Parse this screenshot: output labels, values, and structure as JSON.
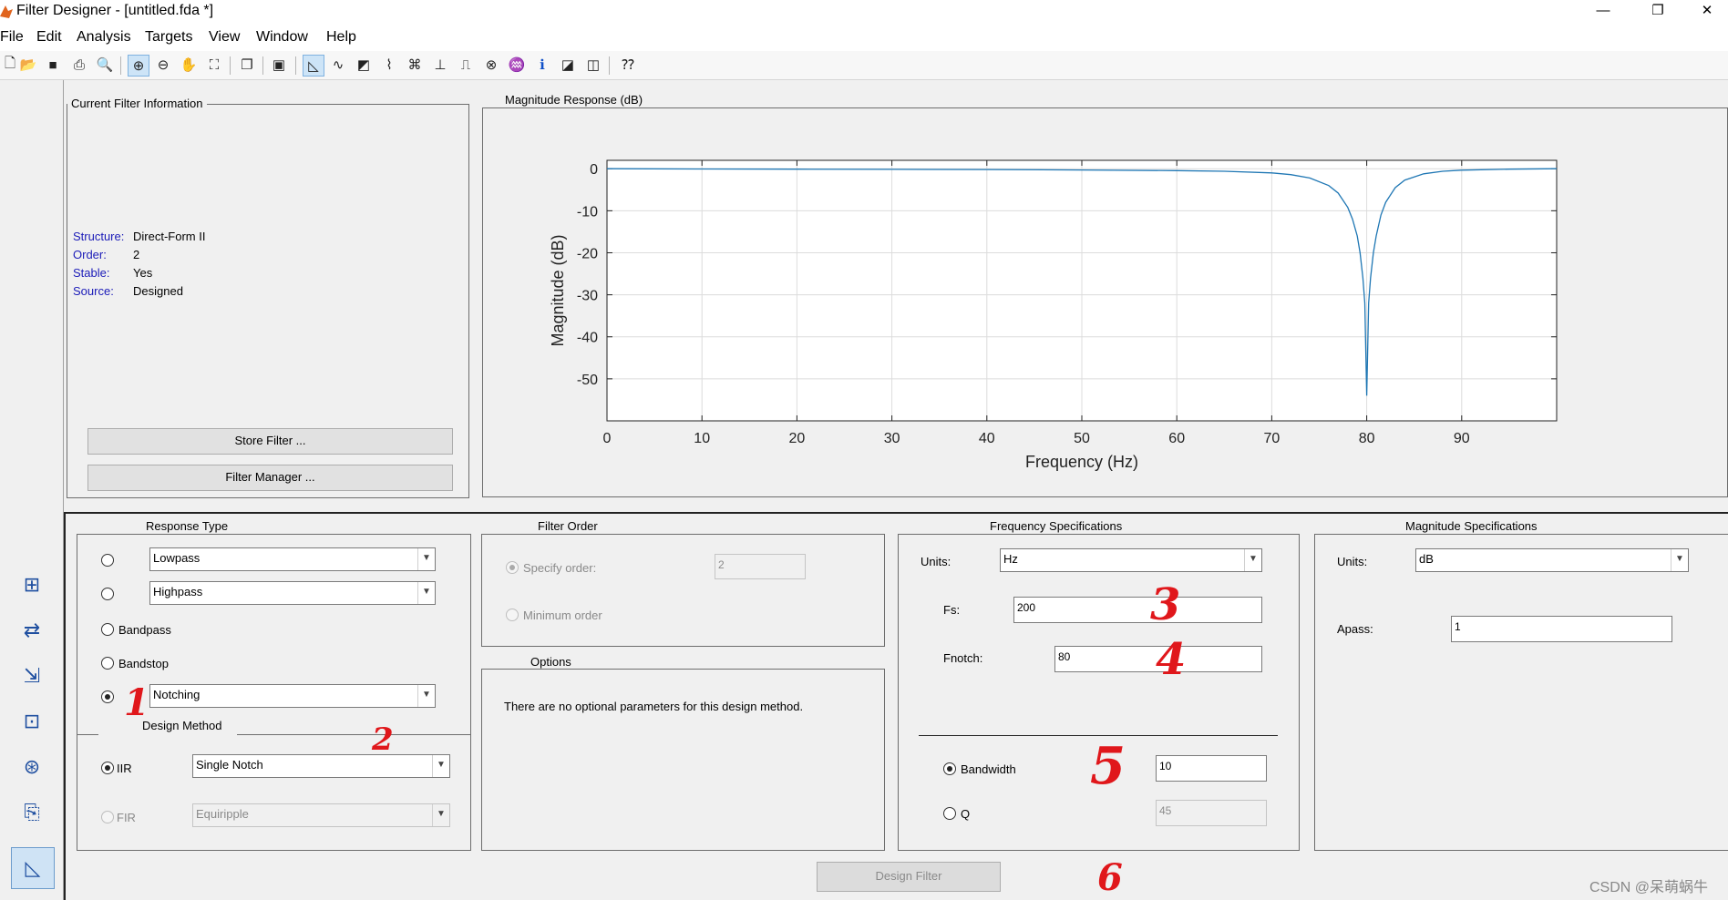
{
  "window": {
    "title": "Filter Designer -  [untitled.fda *]",
    "minimize": "—",
    "maximize": "❐",
    "close": "✕"
  },
  "menu": [
    "File",
    "Edit",
    "Analysis",
    "Targets",
    "View",
    "Window",
    "Help"
  ],
  "toolbar_icons": [
    "new-icon",
    "open-icon",
    "save-icon",
    "print-icon",
    "print-preview-icon",
    "zoom-in-icon",
    "zoom-out-icon",
    "pan-icon",
    "fit-icon",
    "new-figure-icon",
    "filter-specs-icon",
    "magnitude-response-icon",
    "phase-response-icon",
    "mag-phase-icon",
    "group-delay-icon",
    "phase-delay-icon",
    "impulse-response-icon",
    "step-response-icon",
    "pole-zero-icon",
    "coefficients-icon",
    "info-icon",
    "magnitude-estimate-icon",
    "round-off-noise-icon",
    "whats-this-icon"
  ],
  "current_filter": {
    "title": "Current Filter Information",
    "rows": [
      {
        "key": "Structure:",
        "value": "Direct-Form II"
      },
      {
        "key": "Order:",
        "value": "2"
      },
      {
        "key": "Stable:",
        "value": "Yes"
      },
      {
        "key": "Source:",
        "value": "Designed"
      }
    ],
    "store_button": "Store Filter ...",
    "manager_button": "Filter Manager ..."
  },
  "plot_panel": {
    "title": "Magnitude Response (dB)"
  },
  "chart_data": {
    "type": "line",
    "title": "",
    "xlabel": "Frequency (Hz)",
    "ylabel": "Magnitude (dB)",
    "xlim": [
      0,
      100
    ],
    "ylim": [
      -60,
      2
    ],
    "xticks": [
      "0",
      "10",
      "20",
      "30",
      "40",
      "50",
      "60",
      "70",
      "80",
      "90"
    ],
    "yticks": [
      "0",
      "-10",
      "-20",
      "-30",
      "-40",
      "-50"
    ],
    "grid": true,
    "color": "#1f77b4",
    "series": [
      {
        "x": [
          0,
          10,
          20,
          30,
          40,
          50,
          60,
          65,
          70,
          72,
          74,
          76,
          77,
          78,
          78.5,
          79,
          79.3,
          79.6,
          79.8,
          80,
          80.2,
          80.4,
          80.7,
          81,
          81.5,
          82,
          83,
          84,
          86,
          88,
          90,
          95,
          100
        ],
        "values": [
          0,
          -0.05,
          -0.1,
          -0.15,
          -0.2,
          -0.3,
          -0.45,
          -0.6,
          -1,
          -1.4,
          -2.2,
          -4,
          -5.8,
          -9.2,
          -12,
          -16,
          -20,
          -26,
          -32,
          -54,
          -32,
          -26,
          -20,
          -16,
          -11,
          -8,
          -4.5,
          -2.7,
          -1.2,
          -0.6,
          -0.35,
          -0.1,
          0
        ]
      }
    ]
  },
  "response_type": {
    "title": "Response Type",
    "options": [
      {
        "type": "select",
        "value": "Lowpass",
        "checked": false
      },
      {
        "type": "select",
        "value": "Highpass",
        "checked": false
      },
      {
        "type": "label",
        "value": "Bandpass",
        "checked": false
      },
      {
        "type": "label",
        "value": "Bandstop",
        "checked": false
      },
      {
        "type": "select",
        "value": "Notching",
        "checked": true
      }
    ]
  },
  "design_method": {
    "title": "Design Method",
    "iir_label": "IIR",
    "iir_value": "Single Notch",
    "fir_label": "FIR",
    "fir_value": "Equiripple"
  },
  "filter_order": {
    "title": "Filter Order",
    "specify_label": "Specify order:",
    "specify_value": "2",
    "minimum_label": "Minimum order"
  },
  "options": {
    "title": "Options",
    "text": "There are no optional parameters for this design method."
  },
  "frequency_specs": {
    "title": "Frequency Specifications",
    "units_label": "Units:",
    "units_value": "Hz",
    "fs_label": "Fs:",
    "fs_value": "200",
    "fnotch_label": "Fnotch:",
    "fnotch_value": "80",
    "bandwidth_label": "Bandwidth",
    "bandwidth_value": "10",
    "q_label": "Q",
    "q_value": "45"
  },
  "magnitude_specs": {
    "title": "Magnitude Specifications",
    "units_label": "Units:",
    "units_value": "dB",
    "apass_label": "Apass:",
    "apass_value": "1"
  },
  "design_button": "Design Filter",
  "annotations": [
    "1",
    "2",
    "3",
    "4",
    "5",
    "6"
  ],
  "watermark": "CSDN @呆萌蜗牛"
}
